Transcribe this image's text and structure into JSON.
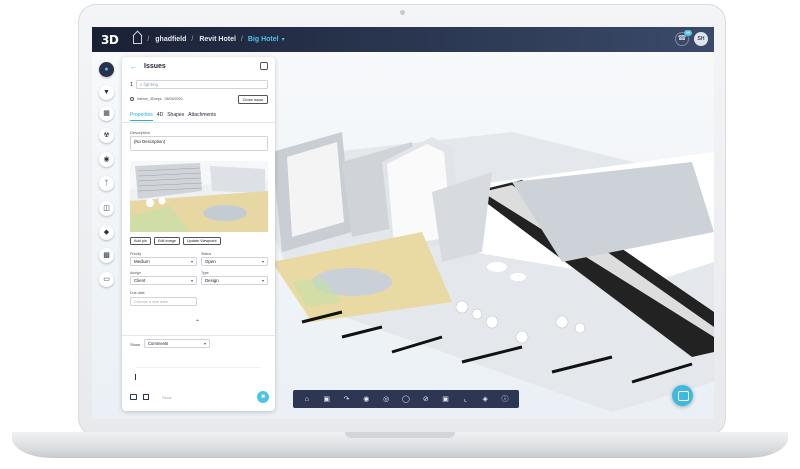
{
  "app": {
    "logo": "3D"
  },
  "breadcrumb": {
    "user": "ghadfield",
    "sep1": "/",
    "project": "Revit Hotel",
    "sep2": "/",
    "model": "Big Hotel",
    "chevron": "▾"
  },
  "header_right": {
    "notifications_badge": "99",
    "avatar_initials": "SH"
  },
  "rail": {
    "items": [
      "pin-icon",
      "filter-icon",
      "grid-icon",
      "radiation-icon",
      "camera-icon",
      "tree-icon",
      "section-icon",
      "layers-icon",
      "calendar-icon",
      "card-icon"
    ]
  },
  "panel": {
    "title": "Issues",
    "issue_number": "1",
    "title_placeholder": "x fighting",
    "meta_user": "interne_3Dreps",
    "meta_date": "08/05/2020",
    "close_issue_label": "Close issue",
    "tabs": [
      "Properties",
      "4D",
      "Shapes",
      "Attachments"
    ],
    "description_label": "Description",
    "description_value": "(No Description)",
    "actions": [
      "Add pin",
      "Edit image",
      "Update Viewpoint"
    ],
    "priority_label": "Priority",
    "priority_value": "Medium",
    "status_label": "Status",
    "status_value": "Open",
    "assign_label": "Assign",
    "assign_value": "Client",
    "type_label": "Type",
    "type_value": "Design",
    "due_date_label": "Due date",
    "due_date_placeholder": "Choose a due date",
    "show_label": "Show",
    "show_value": "Comments",
    "send_label": "Send"
  },
  "toolbar": {
    "icons": [
      "home-icon",
      "cube-icon",
      "redo-icon",
      "eye-icon",
      "eye-off-icon",
      "eye-outline-icon",
      "eye-crossed-icon",
      "focus-icon",
      "crop-icon",
      "target-icon",
      "info-icon"
    ]
  },
  "colors": {
    "accent": "#4dc3e6",
    "topbar": "#1a2035",
    "toolbar": "#2d3754"
  }
}
